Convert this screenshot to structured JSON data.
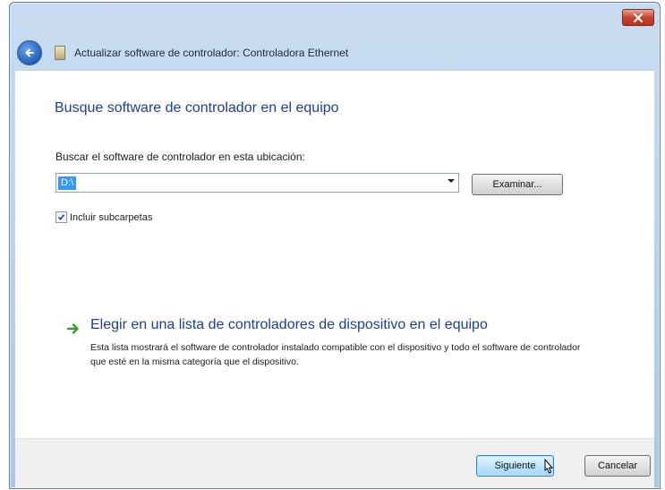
{
  "window": {
    "title": "Actualizar software de controlador: Controladora Ethernet",
    "close_icon": "close-icon",
    "back_icon": "back-arrow-icon",
    "device_icon": "device-icon"
  },
  "content": {
    "heading": "Busque software de controlador en el equipo",
    "path_label": "Buscar el software de controlador en esta ubicación:",
    "path_value": "D:\\",
    "browse_label": "Examinar...",
    "include_subfolders_label": "Incluir subcarpetas",
    "include_subfolders_checked": true,
    "option_title": "Elegir en una lista de controladores de dispositivo en el equipo",
    "option_description": "Esta lista mostrará el software de controlador instalado compatible con el dispositivo y todo el software de controlador que esté en la misma categoría que el dispositivo."
  },
  "footer": {
    "next_label": "Siguiente",
    "cancel_label": "Cancelar"
  },
  "colors": {
    "heading": "#1c3f94",
    "selection": "#3399ff",
    "link_arrow": "#3a9a2f"
  }
}
